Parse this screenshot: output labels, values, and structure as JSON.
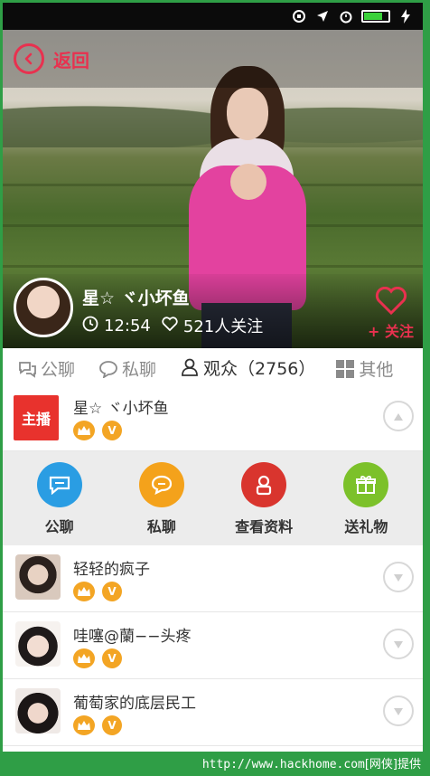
{
  "header": {
    "back_label": "返回"
  },
  "host": {
    "name": "星☆ ヾ小坏鱼",
    "duration": "12:54",
    "followers": "521人关注",
    "follow_label": "+ 关注"
  },
  "tabs": [
    {
      "label": "公聊",
      "icon": "chat-bubbles-icon"
    },
    {
      "label": "私聊",
      "icon": "chat-bubble-icon"
    },
    {
      "label": "观众（2756）",
      "icon": "audience-icon",
      "active": true
    },
    {
      "label": "其他",
      "icon": "grid-icon"
    }
  ],
  "host_row": {
    "tag": "主播",
    "name": "星☆ ヾ小坏鱼"
  },
  "actions": [
    {
      "label": "公聊",
      "icon": "public-chat-icon",
      "color": "#2a9de3"
    },
    {
      "label": "私聊",
      "icon": "private-chat-icon",
      "color": "#f4a21b"
    },
    {
      "label": "查看资料",
      "icon": "profile-icon",
      "color": "#d9352e"
    },
    {
      "label": "送礼物",
      "icon": "gift-icon",
      "color": "#7cc12a"
    }
  ],
  "audience": [
    {
      "name": "轻轻的疯子"
    },
    {
      "name": "哇噻@蘭−−头疼"
    },
    {
      "name": "葡萄家的底层民工"
    }
  ],
  "badge_v": "V",
  "watermark": {
    "url": "http://www.hackhome.com",
    "suffix": "[网侠]提供"
  },
  "colors": {
    "accent": "#e8314f",
    "background": "#2f9e46"
  }
}
